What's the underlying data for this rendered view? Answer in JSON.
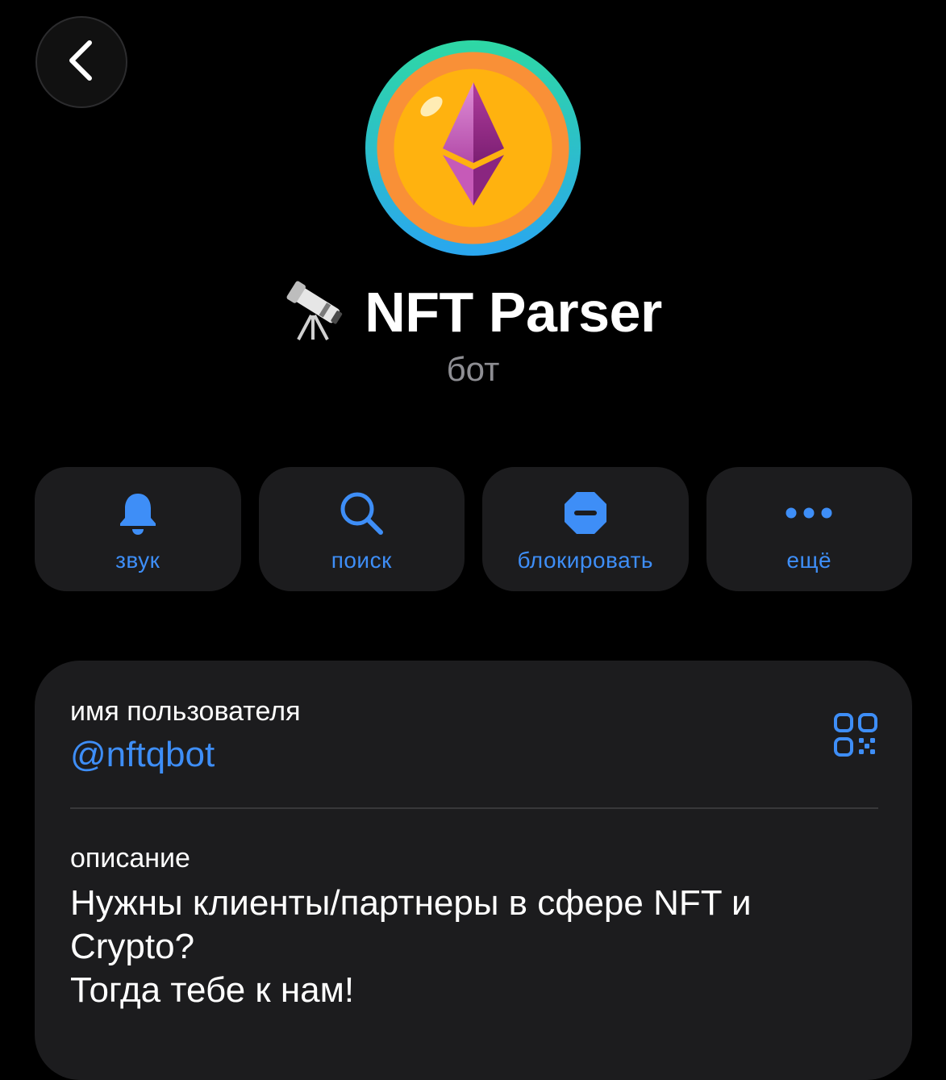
{
  "header": {
    "back_icon": "chevron-left-icon"
  },
  "profile": {
    "avatar_icon": "ethereum-coin-avatar",
    "title_emoji_icon": "telescope-icon",
    "title": "NFT Parser",
    "subtitle": "бот"
  },
  "actions": [
    {
      "icon": "bell-icon",
      "label": "звук"
    },
    {
      "icon": "search-icon",
      "label": "поиск"
    },
    {
      "icon": "block-icon",
      "label": "блокировать"
    },
    {
      "icon": "more-dots-icon",
      "label": "ещё"
    }
  ],
  "info": {
    "username_label": "имя пользователя",
    "username": "@nftqbot",
    "qr_icon": "qr-code-icon",
    "description_label": "описание",
    "description_lines": [
      "Нужны клиенты/партнеры в сфере NFT и",
      "Crypto?",
      "Тогда тебе к нам!"
    ]
  },
  "colors": {
    "background": "#000000",
    "card": "#1c1c1e",
    "accent": "#3e8ef7",
    "secondary_text": "#8e8e93",
    "divider": "#38383a"
  }
}
